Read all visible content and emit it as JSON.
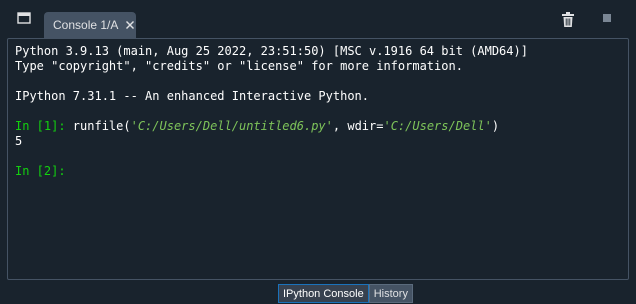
{
  "toolbar": {
    "tab_label": "Console 1/A",
    "close_icon": "close-icon",
    "browse_icon": "window-browse-icon",
    "trash_icon": "trash-icon",
    "stop_icon": "stop-icon"
  },
  "console": {
    "banner_line1": "Python 3.9.13 (main, Aug 25 2022, 23:51:50) [MSC v.1916 64 bit (AMD64)]",
    "banner_line2": "Type \"copyright\", \"credits\" or \"license\" for more information.",
    "ipython_line": "IPython 7.31.1 -- An enhanced Interactive Python.",
    "in1_prompt": "In [1]: ",
    "in1_func": "runfile(",
    "in1_arg1": "'C:/Users/Dell/untitled6.py'",
    "in1_mid": ", wdir=",
    "in1_arg2": "'C:/Users/Dell'",
    "in1_close": ")",
    "out1": "5",
    "in2_prompt": "In [2]:"
  },
  "bottom_tabs": {
    "ipython_console": "IPython Console",
    "history": "History"
  },
  "colors": {
    "background": "#19232d",
    "tab": "#455364",
    "prompt": "#13d10f",
    "string": "#7ec45a"
  }
}
